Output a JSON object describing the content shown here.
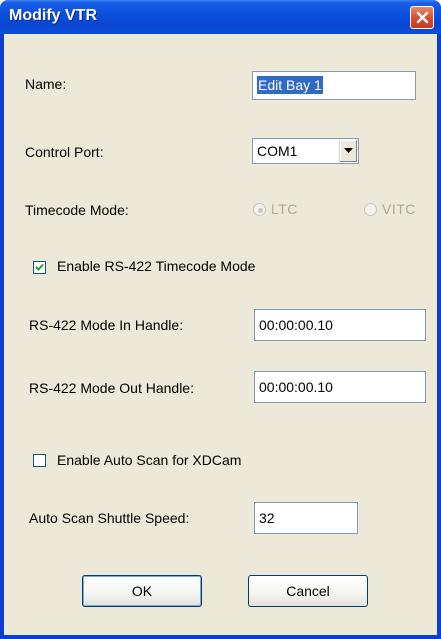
{
  "window": {
    "title": "Modify VTR"
  },
  "fields": {
    "name_label": "Name:",
    "name_value": "Edit Bay 1",
    "control_port_label": "Control Port:",
    "control_port_value": "COM1",
    "timecode_mode_label": "Timecode Mode:",
    "timecode_options": [
      "LTC",
      "VITC"
    ],
    "timecode_selected": "LTC",
    "enable_rs422_label": "Enable RS-422 Timecode Mode",
    "enable_rs422_checked": true,
    "in_handle_label": "RS-422 Mode In Handle:",
    "in_handle_value": "00:00:00.10",
    "out_handle_label": "RS-422 Mode Out Handle:",
    "out_handle_value": "00:00:00.10",
    "auto_scan_label": "Enable Auto Scan for XDCam",
    "auto_scan_checked": false,
    "shuttle_speed_label": "Auto Scan Shuttle Speed:",
    "shuttle_speed_value": "32"
  },
  "buttons": {
    "ok": "OK",
    "cancel": "Cancel"
  },
  "icons": {
    "close": "close-icon",
    "dropdown": "chevron-down-icon",
    "check": "checkmark-icon"
  },
  "colors": {
    "titlebar": "#0a4fdc",
    "close_button": "#d9502f",
    "dialog_background": "#ece9d8",
    "selection": "#316ac5"
  }
}
